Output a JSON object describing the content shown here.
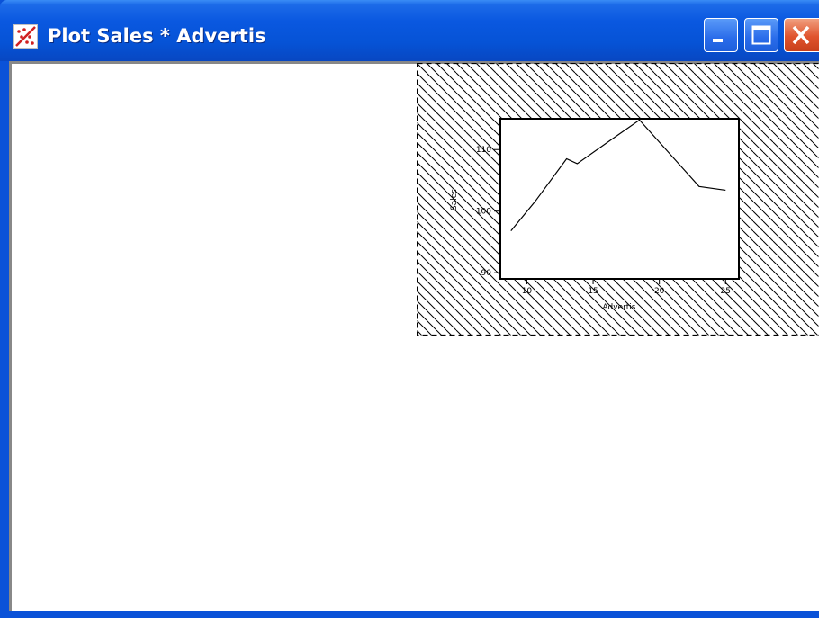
{
  "window": {
    "title": "Plot Sales * Advertis",
    "icon": "scatterplot-icon"
  },
  "buttons": {
    "minimize": "minimize-icon",
    "maximize": "maximize-icon",
    "close": "close-icon"
  },
  "chart_data": {
    "type": "line",
    "xlabel": "Advertis",
    "ylabel": "Sales",
    "x_ticks": [
      10,
      15,
      20,
      25
    ],
    "y_ticks": [
      90,
      100,
      110
    ],
    "xlim": [
      8,
      26
    ],
    "ylim": [
      89,
      115
    ],
    "x": [
      8.8,
      10.6,
      13.0,
      13.8,
      16.5,
      18.5,
      23.0,
      25.0
    ],
    "values": [
      96.8,
      101.5,
      108.5,
      107.7,
      111.8,
      114.8,
      104.0,
      103.4
    ],
    "grid": false,
    "background_pattern": "diagonal-hatch"
  },
  "colors": {
    "titlebar": "#0653d6",
    "close_button": "#e0542e",
    "client_background": "#ffffff"
  }
}
